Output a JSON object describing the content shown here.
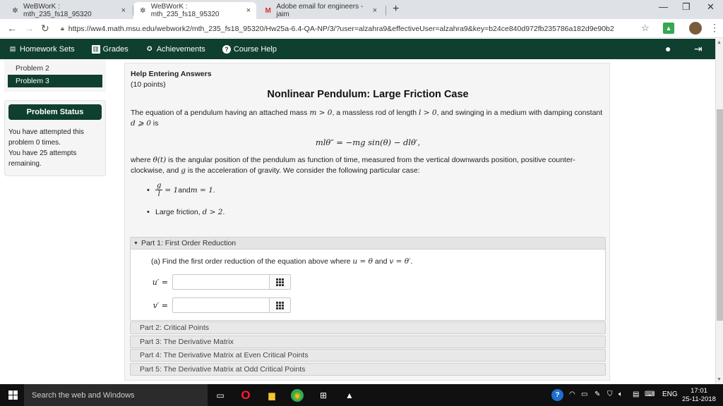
{
  "browser": {
    "tabs": [
      {
        "title": "WeBWorK : mth_235_fs18_95320",
        "close": "×"
      },
      {
        "title": "WeBWorK : mth_235_fs18_95320",
        "close": "×"
      },
      {
        "title": "Adobe email for engineers - jaim",
        "close": "×"
      }
    ],
    "new_tab": "+",
    "window_controls": {
      "minimize": "—",
      "restore": "❐",
      "close": "✕"
    },
    "url": "https://ww4.math.msu.edu/webwork2/mth_235_fs18_95320/Hw25a-6.4-QA-NP/3/?user=alzahra9&effectiveUser=alzahra9&key=b24ce840d972fb235786a182d9e90b2"
  },
  "navbar": {
    "items": [
      "Homework Sets",
      "Grades",
      "Achievements",
      "Course Help"
    ]
  },
  "sidebar": {
    "problems": [
      "Problem 2",
      "Problem 3"
    ],
    "active_problem": "Problem 3",
    "status_title": "Problem Status",
    "status_line1": "You have attempted this problem 0 times.",
    "status_line2": "You have 25 attempts remaining."
  },
  "problem": {
    "help": "Help Entering Answers",
    "points": "(10 points)",
    "title": "Nonlinear Pendulum: Large Friction Case",
    "intro_a": "The equation of a pendulum having an attached mass ",
    "intro_m": "m > 0",
    "intro_b": ", a massless rod of length ",
    "intro_l": "l > 0",
    "intro_c": ", and swinging in a medium with damping constant",
    "intro_d": "d ⩾ 0",
    "intro_e": " is",
    "equation": "mlθ″ = −mg sin(θ) − dlθ′,",
    "where_a": "where ",
    "where_theta": "θ(t)",
    "where_b": " is the angular position of the pendulum as function of time, measured from the vertical downwards position, positive counter-clockwise, and ",
    "where_g": "g",
    "where_c": " is the acceleration of gravity. We consider the following particular case:",
    "case1_num": "g",
    "case1_den": "l",
    "case1_rest_a": " = 1",
    "case1_and": " and ",
    "case1_rest_b": "m = 1",
    "case1_end": ".",
    "case2_text": "Large friction, ",
    "case2_math": "d > 2",
    "case2_end": ".",
    "part1_title": "Part 1: First Order Reduction",
    "part1_q_a": "(a) Find the first order reduction of the equation above where ",
    "part1_q_u": "u = θ",
    "part1_q_and": " and ",
    "part1_q_v": "v = θ′",
    "part1_q_end": ".",
    "ans_u_label": "u′ =",
    "ans_v_label": "v′ =",
    "ans_u_value": "",
    "ans_v_value": "",
    "parts": [
      "Part 2: Critical Points",
      "Part 3: The Derivative Matrix",
      "Part 4: The Derivative Matrix at Even Critical Points",
      "Part 5: The Derivative Matrix at Odd Critical Points"
    ]
  },
  "taskbar": {
    "search_placeholder": "Search the web and Windows",
    "lang": "ENG",
    "time": "17:01",
    "date": "25-11-2018"
  },
  "colors": {
    "navbar_bg": "#0f3f2e",
    "page_panel": "#f5f5f5",
    "taskbar": "#101010"
  }
}
